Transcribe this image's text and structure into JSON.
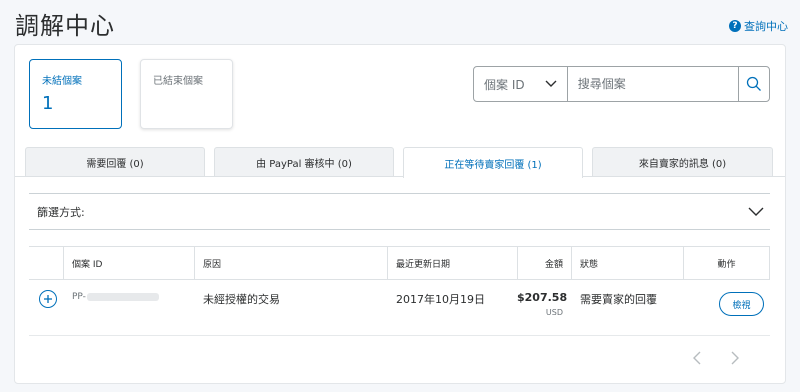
{
  "header": {
    "title": "調解中心",
    "help_label": "查詢中心"
  },
  "cards": [
    {
      "label": "未結個案",
      "count": "1"
    },
    {
      "label": "已結束個案",
      "count": ""
    }
  ],
  "search": {
    "select_value": "個案 ID",
    "placeholder": "搜尋個案"
  },
  "tabs": [
    {
      "label": "需要回覆 (0)"
    },
    {
      "label": "由 PayPal 審核中 (0)"
    },
    {
      "label": "正在等待賣家回覆 (1)"
    },
    {
      "label": "來自賣家的訊息 (0)"
    }
  ],
  "filter": {
    "label": "篩選方式:"
  },
  "table": {
    "columns": [
      "個案 ID",
      "原因",
      "最近更新日期",
      "金額",
      "狀態",
      "動作"
    ],
    "rows": [
      {
        "case_id_prefix": "PP-",
        "reason": "未經授權的交易",
        "updated": "2017年10月19日",
        "amount": "$207.58",
        "currency": "USD",
        "status": "需要賣家的回覆",
        "action": "檢視"
      }
    ]
  },
  "colors": {
    "accent": "#0070ba",
    "text": "#2c2e2f",
    "muted": "#6c7378",
    "background": "#f5f7fa"
  }
}
